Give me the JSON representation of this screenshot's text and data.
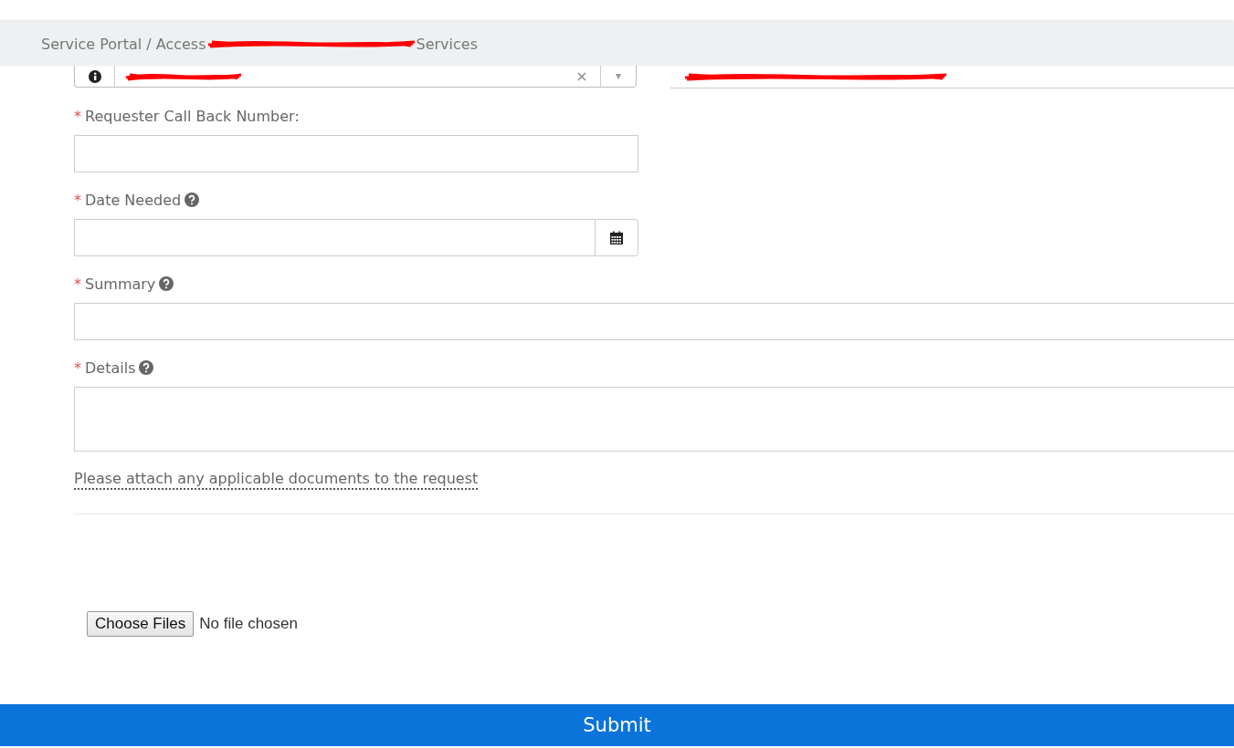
{
  "breadcrumb": {
    "start": "Service Portal / Access",
    "end": "Services"
  },
  "requester_row": {
    "clear": "×",
    "caret": "▾"
  },
  "fields": [
    {
      "kind": "short",
      "label": "Requester Call Back Number:",
      "required_mark": "*",
      "help": false
    },
    {
      "kind": "date",
      "label": "Date Needed",
      "required_mark": "*",
      "help": true
    },
    {
      "kind": "wide",
      "label": "Summary",
      "required_mark": "*",
      "help": true
    },
    {
      "kind": "textarea",
      "label": "Details",
      "required_mark": "*",
      "help": true
    }
  ],
  "attachment_note": "Please attach any applicable documents to the request",
  "file_picker": {
    "button": "Choose Files",
    "status": "No file chosen"
  },
  "submit": "Submit"
}
